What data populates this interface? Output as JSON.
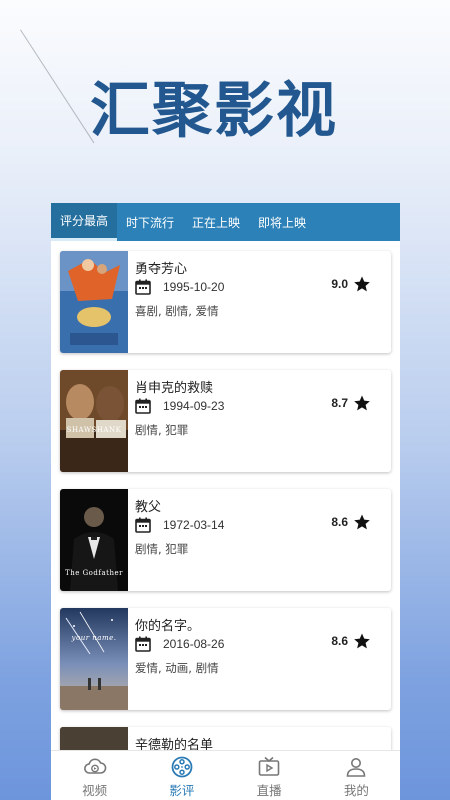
{
  "hero": {
    "title": "汇聚影视"
  },
  "tabs": [
    {
      "label": "评分最高",
      "active": true
    },
    {
      "label": "时下流行",
      "active": false
    },
    {
      "label": "正在上映",
      "active": false
    },
    {
      "label": "即将上映",
      "active": false
    }
  ],
  "movies": [
    {
      "title": "勇夺芳心",
      "date": "1995-10-20",
      "genres": "喜剧, 剧情, 爱情",
      "rating": "9.0",
      "poster_text": ""
    },
    {
      "title": "肖申克的救赎",
      "date": "1994-09-23",
      "genres": "剧情, 犯罪",
      "rating": "8.7",
      "poster_text": "SHAWSHANK"
    },
    {
      "title": "教父",
      "date": "1972-03-14",
      "genres": "剧情, 犯罪",
      "rating": "8.6",
      "poster_text": "The Godfather"
    },
    {
      "title": "你的名字。",
      "date": "2016-08-26",
      "genres": "爱情, 动画, 剧情",
      "rating": "8.6",
      "poster_text": "your name."
    },
    {
      "title": "辛德勒的名单",
      "date": "",
      "genres": "",
      "rating": "",
      "poster_text": ""
    }
  ],
  "bottom_nav": [
    {
      "label": "视频",
      "icon": "video-cloud-icon",
      "active": false
    },
    {
      "label": "影评",
      "icon": "film-reel-icon",
      "active": true
    },
    {
      "label": "直播",
      "icon": "tv-play-icon",
      "active": false
    },
    {
      "label": "我的",
      "icon": "user-icon",
      "active": false
    }
  ],
  "colors": {
    "accent": "#2c82b8",
    "title": "#22588f",
    "nav_active": "#2a7ab5"
  }
}
